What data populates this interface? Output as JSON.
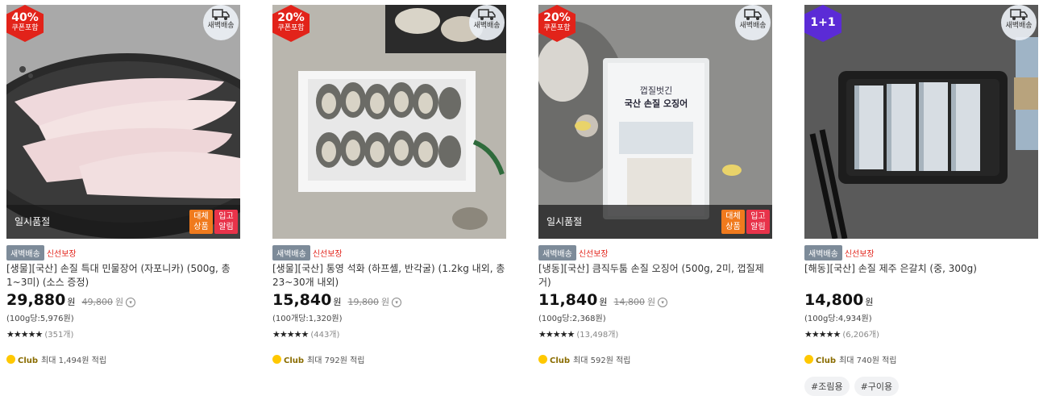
{
  "products": [
    {
      "badge": {
        "type": "discount",
        "value": "40%",
        "sub": "쿠폰포함"
      },
      "dawn_badge": "새벽배송",
      "soldout": {
        "text": "일시품절",
        "substitute": "대체\n상품",
        "restock": "입고\n알림"
      },
      "tags": {
        "dawn": "새벽배송",
        "fresh": "신선보장"
      },
      "title": "[생물][국산] 손질 특대 민물장어 (자포니카) (500g, 총 1~3미) (소스 증정)",
      "price": "29,880",
      "won": "원",
      "original_price": "49,800",
      "original_won": "원",
      "unit_price": "(100g당:5,976원)",
      "stars": "★★★★★",
      "rating": 4.5,
      "reviews": "(351개)",
      "club_label": "Club",
      "club_text": "최대 1,494원 적립",
      "chips": []
    },
    {
      "badge": {
        "type": "discount",
        "value": "20%",
        "sub": "쿠폰포함"
      },
      "dawn_badge": "새벽배송",
      "soldout": null,
      "tags": {
        "dawn": "새벽배송",
        "fresh": "신선보장"
      },
      "title": "[생물][국산] 통영 석화 (하프셸, 반각굴) (1.2kg 내외, 총 23~30개 내외)",
      "price": "15,840",
      "won": "원",
      "original_price": "19,800",
      "original_won": "원",
      "unit_price": "(100개당:1,320원)",
      "stars": "★★★★★",
      "rating": 4.5,
      "reviews": "(443개)",
      "club_label": "Club",
      "club_text": "최대 792원 적립",
      "chips": []
    },
    {
      "badge": {
        "type": "discount",
        "value": "20%",
        "sub": "쿠폰포함"
      },
      "dawn_badge": "새벽배송",
      "soldout": {
        "text": "일시품절",
        "substitute": "대체\n상품",
        "restock": "입고\n알림"
      },
      "tags": {
        "dawn": "새벽배송",
        "fresh": "신선보장"
      },
      "title": "[냉동][국산] 큼직두툼 손질 오징어 (500g, 2미, 껍질제거)",
      "price": "11,840",
      "won": "원",
      "original_price": "14,800",
      "original_won": "원",
      "unit_price": "(100g당:2,368원)",
      "stars": "★★★★★",
      "rating": 4.8,
      "reviews": "(13,498개)",
      "club_label": "Club",
      "club_text": "최대 592원 적립",
      "chips": [],
      "package_text": {
        "line1": "껍질벗긴",
        "line2": "국산 손질 오징어"
      }
    },
    {
      "badge": {
        "type": "plus",
        "value": "1+1",
        "sub": ""
      },
      "dawn_badge": "새벽배송",
      "soldout": null,
      "tags": {
        "dawn": "새벽배송",
        "fresh": "신선보장"
      },
      "title": "[해동][국산] 손질 제주 은갈치 (중, 300g)",
      "price": "14,800",
      "won": "원",
      "original_price": "",
      "original_won": "",
      "unit_price": "(100g당:4,934원)",
      "stars": "★★★★★",
      "rating": 4.7,
      "reviews": "(6,206개)",
      "club_label": "Club",
      "club_text": "최대 740원 적립",
      "chips": [
        "#조림용",
        "#구이용"
      ]
    }
  ],
  "colors": {
    "discount_badge": "#e2231a",
    "plus_badge": "#5b2bd6",
    "dawn_tag": "#7d8b99",
    "fresh_tag": "#e2231a",
    "substitute_button": "#f07a1d",
    "restock_button": "#e8334a",
    "club_icon": "#ffc800"
  },
  "icons": [
    "truck-icon",
    "info-circle-icon",
    "star-icon",
    "club-coin-icon"
  ]
}
